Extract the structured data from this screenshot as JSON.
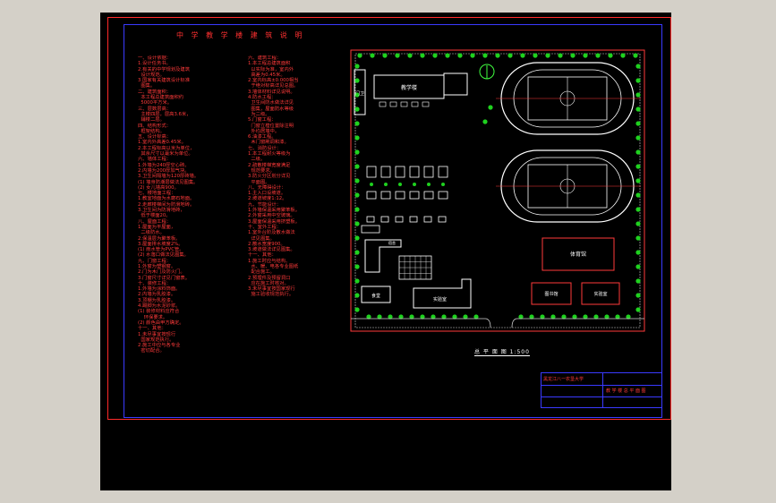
{
  "drawing": {
    "title": "中 学 教 学 楼 建 筑 说 明",
    "caption": "总 平 面 图 1:500",
    "title_block": {
      "school": "黑龙江八一农垦大学",
      "drawing_name": "教 学 楼 总 平 面 图"
    }
  },
  "notes_col1": "一、设计依据：\n1.设计任务书。\n2.有关的中学规划及建筑\n  设计规范。\n3.国家有关建筑设计标准\n  图集。\n二、建筑面积：\n  本工程总建筑面积约\n  5000平方米。\n三、层数层高：\n  主楼四层，层高3.6米，\n  辅楼二层。\n四、结构形式：\n  框架结构。\n五、设计标高：\n1.室内外高差0.45米。\n2.本工程标高以米为单位，\n  其余尺寸以毫米为单位。\n六、墙体工程：\n1.外墙为240厚空心砖。\n2.内墙为200厚加气块。\n3.卫生间隔墙为120厚砖墙。\n(1) 墙身防潮层做法见图集。\n(2) 女儿墙高900。\n七、楼地面工程：\n1.教室地面为水磨石地面。\n2.走廊楼梯间为防滑地砖。\n3.卫生间为防滑地砖，\n  低于楼面20。\n八、屋面工程：\n1.屋面为平屋面，\n  二级防水。\n2.保温层为聚苯板。\n3.屋面排水坡度2%。\n(1) 雨水管为PVC管。\n(2) 水落口做法见图集。\n九、门窗工程：\n1.外窗为塑钢窗。\n2.门为木门及防火门。\n3.门窗尺寸详见门窗表。\n十、装修工程：\n1.外墙为涂料饰面。\n2.内墙为乳胶漆。\n3.顶棚为乳胶漆。\n4.踢脚为水泥砂浆。\n(1) 装修材料应符合\n    环保要求。\n(2) 颜色由甲方确定。\n十一、其他：\n1.未尽事宜按现行\n  国家规范执行。\n2.施工中应与各专业\n  密切配合。",
  "notes_col2": "六、建筑工程：\n1.本工程总建筑面积\n  以实际为准，室内外\n  高差为0.45米。\n2.室内标高±0.000相当\n  于绝对标高详见总图。\n3.墙体材料详见说明。\n4.防水工程：\n  卫生间防水做法详见\n  图集，屋面防水等级\n  为二级。\n5.门窗工程：\n  门窗立樘位置除注明\n  外均居墙中。\n6.油漆工程。\n  木门窗刷调和漆。\n七、消防设计：\n1.本工程耐火等级为\n  二级。\n2.疏散楼梯宽度满足\n  规范要求。\n3.防火分区划分详见\n  平面图。\n八、无障碍设计：\n1.主入口设坡道。\n2.坡道坡度1:12。\n九、节能设计：\n1.外墙保温采用聚苯板。\n2.外窗采用中空玻璃。\n3.屋面保温采用挤塑板。\n十、室外工程：\n1.室外台阶及散水做法\n  详见图集。\n2.散水宽度900。\n3.坡道做法详见图集。\n十一、其他：\n1.施工时应与结构、\n  水、暖、电各专业图纸\n  配合施工。\n2.预埋件及预留洞口\n  应在施工时核对。\n3.未尽事宜按国家现行\n  施工验收规范执行。",
  "site": {
    "teaching_building": "教学楼",
    "gate_house": "门卫",
    "gym": "体育馆",
    "library": "图书馆",
    "lab": "实验室",
    "canteen": "食堂",
    "dorm": "宿舍"
  }
}
